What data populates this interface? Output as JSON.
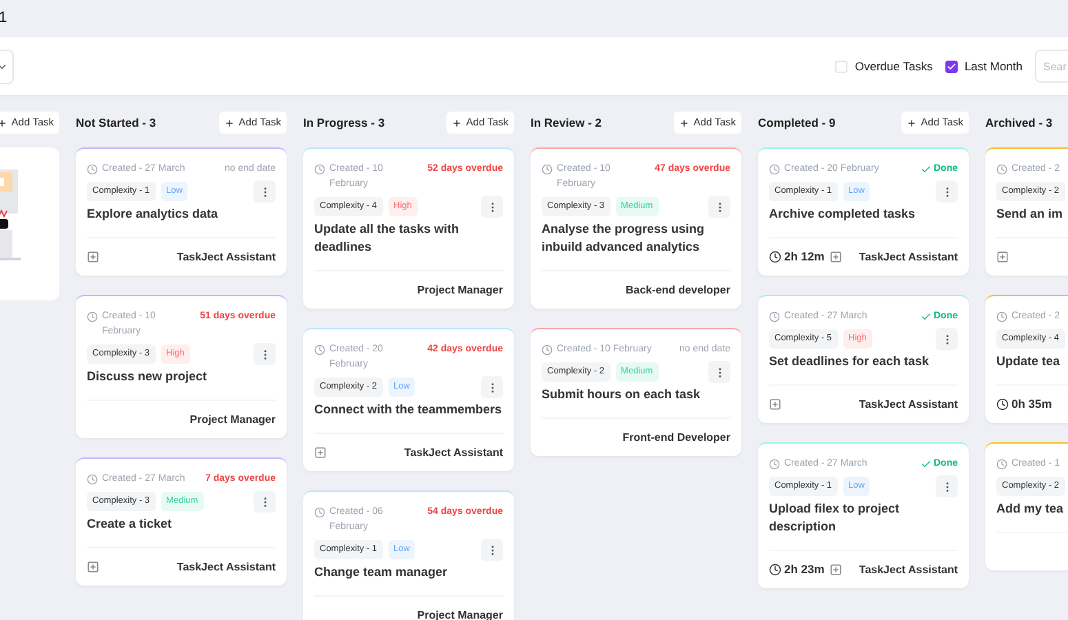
{
  "top_bar": {
    "heading": "1"
  },
  "toolbar": {
    "filters": [
      {
        "label": "Overdue Tasks",
        "checked": false
      },
      {
        "label": "Last Month",
        "checked": true
      }
    ],
    "search": {
      "placeholder": "Sear"
    }
  },
  "partial_column": {
    "add_button": "Add Task"
  },
  "columns": [
    {
      "title": "Not Started - 3",
      "add_button": "Add Task",
      "color": "#c4b5fd",
      "cards": [
        {
          "created": "Created - 27 March",
          "status": {
            "kind": "none",
            "text": "no end date"
          },
          "complexity": "Complexity - 1",
          "priority": {
            "label": "Low",
            "color": "#60a5fa"
          },
          "title": "Explore analytics data",
          "icon": true,
          "assignee": "TaskJect Assistant"
        },
        {
          "created": "Created - 10 February",
          "status": {
            "kind": "overdue",
            "text": "51 days overdue"
          },
          "complexity": "Complexity - 3",
          "priority": {
            "label": "High",
            "color": "#f87171"
          },
          "title": "Discuss new project",
          "icon": false,
          "assignee": "Project Manager"
        },
        {
          "created": "Created - 27 March",
          "status": {
            "kind": "overdue",
            "text": "7 days overdue"
          },
          "complexity": "Complexity - 3",
          "priority": {
            "label": "Medium",
            "color": "#34d399"
          },
          "title": "Create a ticket",
          "icon": true,
          "assignee": "TaskJect Assistant"
        }
      ]
    },
    {
      "title": "In Progress - 3",
      "add_button": "Add Task",
      "color": "#bae6fd",
      "cards": [
        {
          "created": "Created - 10 February",
          "status": {
            "kind": "overdue",
            "text": "52 days overdue"
          },
          "complexity": "Complexity - 4",
          "priority": {
            "label": "High",
            "color": "#f87171"
          },
          "title": "Update all the tasks with deadlines",
          "icon": false,
          "assignee": "Project Manager"
        },
        {
          "created": "Created - 20 February",
          "status": {
            "kind": "overdue",
            "text": "42 days overdue"
          },
          "complexity": "Complexity - 2",
          "priority": {
            "label": "Low",
            "color": "#60a5fa"
          },
          "title": "Connect with the teammembers",
          "icon": true,
          "assignee": "TaskJect Assistant"
        },
        {
          "created": "Created - 06 February",
          "status": {
            "kind": "overdue",
            "text": "54 days overdue"
          },
          "complexity": "Complexity - 1",
          "priority": {
            "label": "Low",
            "color": "#60a5fa"
          },
          "title": "Change team manager",
          "icon": false,
          "assignee": "Project Manager"
        }
      ]
    },
    {
      "title": "In Review - 2",
      "add_button": "Add Task",
      "color": "#fca5a5",
      "cards": [
        {
          "created": "Created - 10 February",
          "status": {
            "kind": "overdue",
            "text": "47 days overdue"
          },
          "complexity": "Complexity - 3",
          "priority": {
            "label": "Medium",
            "color": "#34d399"
          },
          "title": "Analyse the progress using inbuild advanced analytics",
          "icon": false,
          "assignee": "Back-end developer"
        },
        {
          "created": "Created - 10 February",
          "status": {
            "kind": "none",
            "text": "no end date"
          },
          "complexity": "Complexity - 2",
          "priority": {
            "label": "Medium",
            "color": "#34d399"
          },
          "title": "Submit hours on each task",
          "icon": false,
          "assignee": "Front-end Developer"
        }
      ]
    },
    {
      "title": "Completed - 9",
      "add_button": "Add Task",
      "color": "#99f6e4",
      "cards": [
        {
          "created": "Created - 20 February",
          "status": {
            "kind": "done",
            "text": "Done"
          },
          "complexity": "Complexity - 1",
          "priority": {
            "label": "Low",
            "color": "#60a5fa"
          },
          "title": "Archive completed tasks",
          "time": "2h 12m",
          "icon": true,
          "assignee": "TaskJect Assistant"
        },
        {
          "created": "Created - 27 March",
          "status": {
            "kind": "done",
            "text": "Done"
          },
          "complexity": "Complexity - 5",
          "priority": {
            "label": "High",
            "color": "#f87171"
          },
          "title": "Set deadlines for each task",
          "icon": true,
          "assignee": "TaskJect Assistant"
        },
        {
          "created": "Created - 27 March",
          "status": {
            "kind": "done",
            "text": "Done"
          },
          "complexity": "Complexity - 1",
          "priority": {
            "label": "Low",
            "color": "#60a5fa"
          },
          "title": "Upload filex to project description",
          "time": "2h 23m",
          "icon": true,
          "assignee": "TaskJect Assistant"
        }
      ]
    },
    {
      "title": "Archived - 3",
      "color": "#fbbf24",
      "cards": [
        {
          "created": "Created - 2",
          "complexity": "Complexity - 2",
          "title": "Send an im",
          "icon": true
        },
        {
          "created": "Created - 2",
          "complexity": "Complexity - 4",
          "title": "Update tea",
          "time": "0h 35m",
          "icon": false
        },
        {
          "created": "Created - 1",
          "complexity": "Complexity - 2",
          "title": "Add my tea",
          "icon": false
        }
      ]
    }
  ]
}
